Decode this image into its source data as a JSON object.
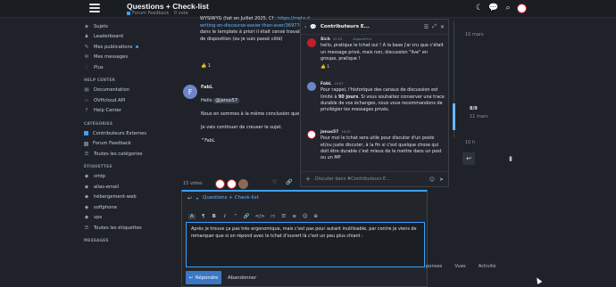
{
  "header": {
    "title": "Questions + Check-list",
    "category": "Forum Feedback",
    "votes": "0 vote"
  },
  "sidebar": {
    "items": [
      {
        "icon": "layers-icon",
        "label": "Sujets"
      },
      {
        "icon": "people-icon",
        "label": "Leaderboard"
      },
      {
        "icon": "pencil-icon",
        "label": "Mes publications"
      },
      {
        "icon": "envelope-icon",
        "label": "Mes messages"
      },
      {
        "icon": "ellipsis-icon",
        "label": "Plus"
      }
    ],
    "help_heading": "HELP CENTER",
    "help_items": [
      {
        "icon": "book-icon",
        "label": "Documentation"
      },
      {
        "icon": "code-icon",
        "label": "OVHcloud API"
      },
      {
        "icon": "help-icon",
        "label": "Help Center"
      }
    ],
    "categories_heading": "CATÉGORIES",
    "categories": [
      {
        "label": "Contributeurs Externes",
        "color": "#3ba0ff"
      },
      {
        "label": "Forum Feedback",
        "color": "#6b7785"
      },
      {
        "label": "Toutes les catégories",
        "color": ""
      }
    ],
    "tags_heading": "ÉTIQUETTES",
    "tags": [
      "smtp",
      "alias-email",
      "hébergement-web",
      "softphone",
      "vps",
      "Toutes les étiquettes"
    ],
    "messages_heading": "MESSAGES"
  },
  "post1": {
    "text_a": "WYSIWYG (fait en Juillet 2025, Cf : ",
    "link_a": "https://meta.d",
    "link_b": "writing-on-discourse-easier-than-ever/369770",
    "text_b": "dans le template à priori il était censé travailler s",
    "text_c": "de disposition (ou je suis passé côté)",
    "reaction": "1"
  },
  "post2": {
    "avatar_letter": "F",
    "author": "FabL",
    "greeting": "Hello ",
    "mention": "@janus57",
    "l1": "Nous en sommes à la même conclusion que toi.",
    "l2": "Je vais continuer de creuser le sujet.",
    "l3": "^FabL"
  },
  "post_footer": {
    "votes": "15 votes"
  },
  "chat": {
    "title": "Contributeurs E...",
    "messages": [
      {
        "author": "Sich",
        "time": "22:03",
        "time2": "Aujourd'hui",
        "text": "hello, pratique le tchat oui ! A la base j'ai cru que c'était un message privé, mais non, discussion \"live\" en groupe, pratique !",
        "reaction": "1"
      },
      {
        "author": "FabL",
        "time": "15:07",
        "text_a": "Pour rappel, l'historique des canaux de discussion est limité à ",
        "bold": "90 jours",
        "text_b": ". Si vous souhaitez conserver une trace durable de vos échanges, nous vous recommandons de privilégier les messages privés."
      },
      {
        "author": "janus57",
        "time": "18:35",
        "text": "Pour moi le tchat sera utile pour discuter d'un poste et/ou juste discuter, à la fin si c'est quelque chose qui doit être durable c'est mieux de le mettre dans un post ou un MP"
      }
    ],
    "input_placeholder": "Discuter dans #Contributeurs E..."
  },
  "timeline": {
    "start": "10 mars",
    "current": "8/9",
    "current_date": "11 mars",
    "end": "10 h"
  },
  "composer": {
    "topic": "Questions + Check-list",
    "body": "Après je trouve ça pas très ergonomique, mais c'est pas pour autant inutilisable, par contre je viens de remarquer que si on répond avec le tchat d'ouvert là c'est un peu plus chiant :",
    "submit": "Répondre",
    "cancel": "Abandonner",
    "toolbar": [
      "A",
      "¶",
      "B",
      "I",
      "“",
      "🔗",
      "</>",
      "▭",
      "☰",
      "≡",
      "☺",
      "⊕"
    ]
  },
  "bottom_tabs": [
    "ponses",
    "Vues",
    "Activité"
  ]
}
